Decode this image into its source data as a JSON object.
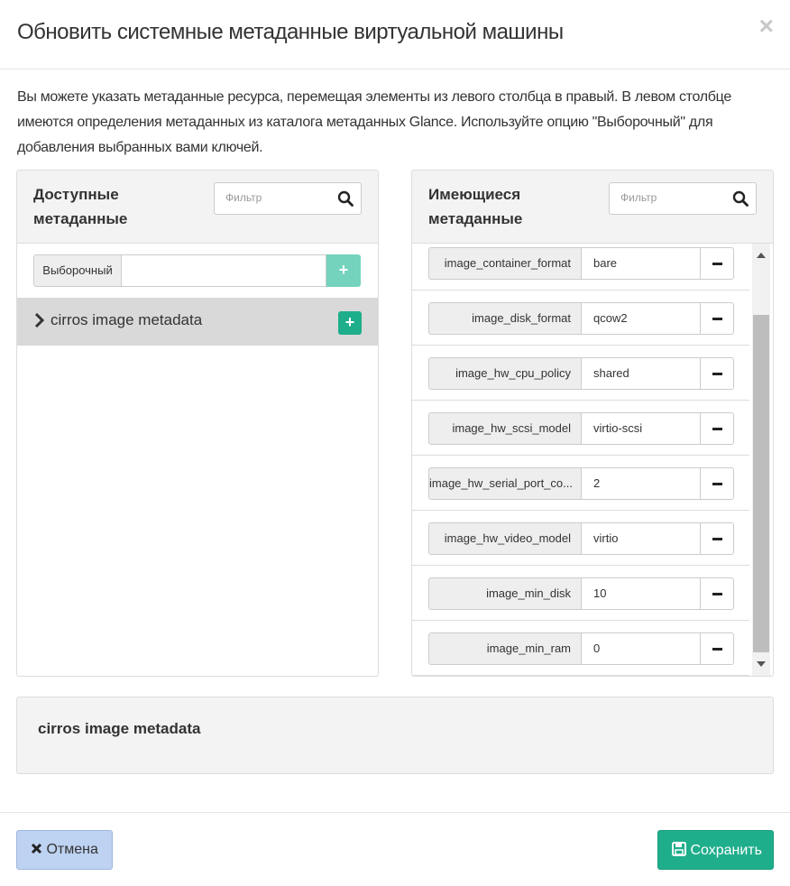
{
  "modal": {
    "title": "Обновить системные метаданные виртуальной машины",
    "close": "×",
    "intro": "Вы можете указать метаданные ресурса, перемещая элементы из левого столбца в правый. В левом столбце имеются определения метаданных из каталога метаданных Glance. Используйте опцию \"Выборочный\" для добавления выбранных вами ключей."
  },
  "available": {
    "title": "Доступные метаданные",
    "filter_placeholder": "Фильтр",
    "custom_label": "Выборочный",
    "custom_value": "",
    "add_icon": "+",
    "namespaces": [
      {
        "label": "cirros image metadata"
      }
    ]
  },
  "existing": {
    "title": "Имеющиеся метаданные",
    "filter_placeholder": "Фильтр",
    "items": [
      {
        "key": "image_container_format",
        "value": "bare"
      },
      {
        "key": "image_disk_format",
        "value": "qcow2"
      },
      {
        "key": "image_hw_cpu_policy",
        "value": "shared"
      },
      {
        "key": "image_hw_scsi_model",
        "value": "virtio-scsi"
      },
      {
        "key": "image_hw_serial_port_co...",
        "value": "2"
      },
      {
        "key": "image_hw_video_model",
        "value": "virtio"
      },
      {
        "key": "image_min_disk",
        "value": "10"
      },
      {
        "key": "image_min_ram",
        "value": "0"
      }
    ]
  },
  "description": {
    "title": "cirros image metadata"
  },
  "footer": {
    "cancel_label": "Отмена",
    "save_label": "Сохранить"
  },
  "colors": {
    "primary": "#1fae8b",
    "cancel_bg": "#bed2f1",
    "panel_header": "#f3f3f3"
  },
  "icons": [
    "close-icon",
    "search-icon",
    "plus-icon",
    "chevron-right-icon",
    "minus-icon",
    "times-icon",
    "floppy-disk-icon"
  ]
}
